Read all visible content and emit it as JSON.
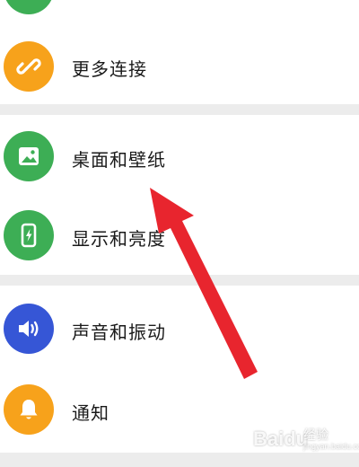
{
  "settings": {
    "items": [
      {
        "label": "更多连接",
        "icon": "link-icon",
        "color": "#f7a21b"
      },
      {
        "label": "桌面和壁纸",
        "icon": "image-icon",
        "color": "#3dae55"
      },
      {
        "label": "显示和亮度",
        "icon": "phone-brightness-icon",
        "color": "#3dae55"
      },
      {
        "label": "声音和振动",
        "icon": "speaker-icon",
        "color": "#3656d6"
      },
      {
        "label": "通知",
        "icon": "bell-icon",
        "color": "#f7a21b"
      }
    ]
  },
  "annotation": {
    "arrow_color": "#e8252e",
    "points_to": "桌面和壁纸"
  },
  "watermark": {
    "brand": "Baidu",
    "subtitle": "经验",
    "url": "jingyan.baidu.com"
  }
}
